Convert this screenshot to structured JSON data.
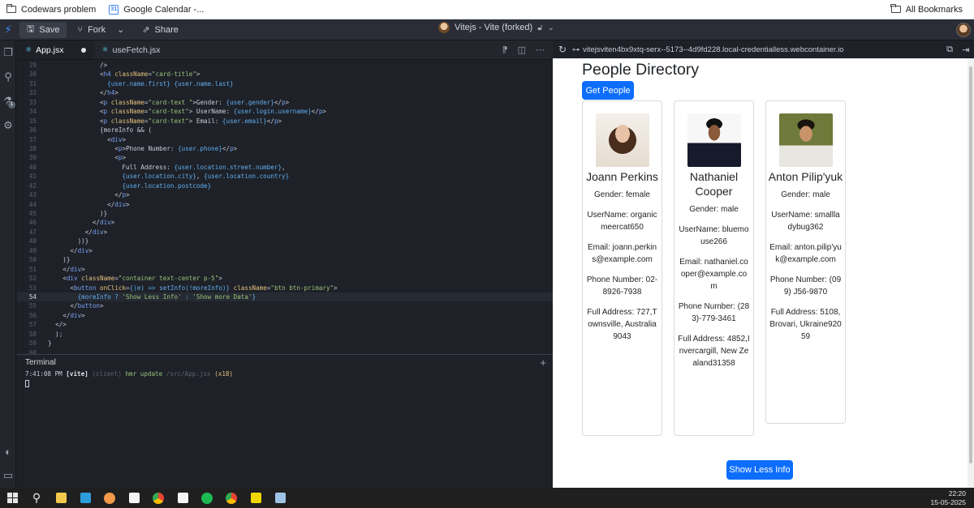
{
  "bookmarks": {
    "items": [
      {
        "label": "Codewars problem",
        "icon": "folder-icon"
      },
      {
        "label": "Google Calendar -...",
        "icon": "calendar-icon"
      }
    ],
    "all_label": "All Bookmarks"
  },
  "header": {
    "save_label": "Save",
    "fork_label": "Fork",
    "share_label": "Share",
    "project_title": "Vitejs - Vite (forked)"
  },
  "editor": {
    "tabs": [
      {
        "label": "App.jsx",
        "modified": true
      },
      {
        "label": "useFetch.jsx",
        "modified": false
      }
    ],
    "current_line": 54
  },
  "code_lines": [
    {
      "n": "29",
      "text": "              />"
    },
    {
      "n": "30",
      "text": "              <h4 className=\"card-title\">"
    },
    {
      "n": "31",
      "text": "                {user.name.first} {user.name.last}"
    },
    {
      "n": "32",
      "text": "              </h4>"
    },
    {
      "n": "33",
      "text": "              <p className=\"card-text \">Gender: {user.gender}</p>"
    },
    {
      "n": "34",
      "text": "              <p className=\"card-text\"> UserName: {user.login.username}</p>"
    },
    {
      "n": "35",
      "text": "              <p className=\"card-text\"> Email: {user.email}</p>"
    },
    {
      "n": "36",
      "text": "              {moreInfo && ("
    },
    {
      "n": "37",
      "text": "                <div>"
    },
    {
      "n": "38",
      "text": "                  <p>Phone Number: {user.phone}</p>"
    },
    {
      "n": "39",
      "text": "                  <p>"
    },
    {
      "n": "40",
      "text": "                    Full Address: {user.location.street.number},"
    },
    {
      "n": "41",
      "text": "                    {user.location.city}, {user.location.country}"
    },
    {
      "n": "42",
      "text": "                    {user.location.postcode}"
    },
    {
      "n": "43",
      "text": "                  </p>"
    },
    {
      "n": "44",
      "text": "                </div>"
    },
    {
      "n": "45",
      "text": "              )}"
    },
    {
      "n": "46",
      "text": "            </div>"
    },
    {
      "n": "47",
      "text": "          </div>"
    },
    {
      "n": "48",
      "text": "        ))}"
    },
    {
      "n": "49",
      "text": "      </div>"
    },
    {
      "n": "50",
      "text": "    )}"
    },
    {
      "n": "51",
      "text": "    </div>"
    },
    {
      "n": "52",
      "text": "    <div className=\"container text-center p-5\">"
    },
    {
      "n": "53",
      "text": "      <button onClick={(e) => setInfo(!moreInfo)} className=\"btn btn-primary\">"
    },
    {
      "n": "54",
      "text": "        {moreInfo ? 'Show Less Info' : 'Show more Data'}"
    },
    {
      "n": "55",
      "text": "      </button>"
    },
    {
      "n": "56",
      "text": "    </div>"
    },
    {
      "n": "57",
      "text": "  </>"
    },
    {
      "n": "58",
      "text": "  );"
    },
    {
      "n": "59",
      "text": "}"
    },
    {
      "n": "60",
      "text": ""
    }
  ],
  "terminal": {
    "title": "Terminal",
    "time": "7:41:08 PM",
    "tag": "[vite]",
    "client": "(client)",
    "msg": "hmr update",
    "file": "/src/App.jsx",
    "count": "(x18)"
  },
  "preview": {
    "url": "vitejsviten4bx9xtq-serx--5173--4d9fd228.local-credentialless.webcontainer.io",
    "title": "People Directory",
    "get_button": "Get People",
    "toggle_button": "Show Less Info",
    "cards": [
      {
        "name": "Joann Perkins",
        "gender": "Gender: female",
        "username": "UserName: organicmeercat650",
        "email": "Email: joann.perkins@example.com",
        "phone": "Phone Number: 02-8926-7938",
        "address": "Full Address: 727,Townsville, Australia9043"
      },
      {
        "name": "Nathaniel Cooper",
        "gender": "Gender: male",
        "username": "UserName: bluemouse266",
        "email": "Email: nathaniel.cooper@example.com",
        "phone": "Phone Number: (283)-779-3461",
        "address": "Full Address: 4852,Invercargill, New Zealand31358"
      },
      {
        "name": "Anton Pilip'yuk",
        "gender": "Gender: male",
        "username": "UserName: smallladybug362",
        "email": "Email: anton.pilip'yuk@example.com",
        "phone": "Phone Number: (099) J56-9870",
        "address": "Full Address: 5108,Brovari, Ukraine92059"
      }
    ]
  },
  "taskbar": {
    "time": "22:20",
    "date": "15-05-2025"
  },
  "colors": {
    "accent": "#0d6efd",
    "editor_bg": "#1e2128"
  }
}
